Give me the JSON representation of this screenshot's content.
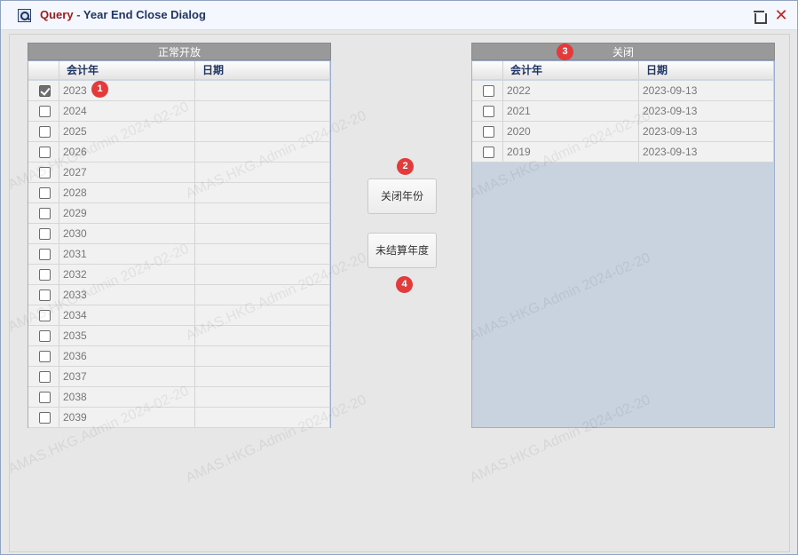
{
  "window": {
    "title_query": "Query",
    "title_sep": " - ",
    "title_main": "Year End Close Dialog",
    "close_glyph": "✕"
  },
  "left": {
    "header": "正常开放",
    "columns": [
      "会计年",
      "日期"
    ],
    "rows": [
      {
        "year": "2023",
        "date": "",
        "checked": true
      },
      {
        "year": "2024",
        "date": ""
      },
      {
        "year": "2025",
        "date": ""
      },
      {
        "year": "2026",
        "date": ""
      },
      {
        "year": "2027",
        "date": ""
      },
      {
        "year": "2028",
        "date": ""
      },
      {
        "year": "2029",
        "date": ""
      },
      {
        "year": "2030",
        "date": ""
      },
      {
        "year": "2031",
        "date": ""
      },
      {
        "year": "2032",
        "date": ""
      },
      {
        "year": "2033",
        "date": ""
      },
      {
        "year": "2034",
        "date": ""
      },
      {
        "year": "2035",
        "date": ""
      },
      {
        "year": "2036",
        "date": ""
      },
      {
        "year": "2037",
        "date": ""
      },
      {
        "year": "2038",
        "date": ""
      },
      {
        "year": "2039",
        "date": ""
      }
    ]
  },
  "right": {
    "header": "关闭",
    "columns": [
      "会计年",
      "日期"
    ],
    "rows": [
      {
        "year": "2022",
        "date": "2023-09-13"
      },
      {
        "year": "2021",
        "date": "2023-09-13"
      },
      {
        "year": "2020",
        "date": "2023-09-13"
      },
      {
        "year": "2019",
        "date": "2023-09-13"
      }
    ]
  },
  "buttons": {
    "close_year": "关闭年份",
    "unclosed_year": "未结算年度"
  },
  "badges": {
    "b1": "1",
    "b2": "2",
    "b3": "3",
    "b4": "4"
  },
  "watermark": "AMAS.HKG.Admin 2024-02-20"
}
